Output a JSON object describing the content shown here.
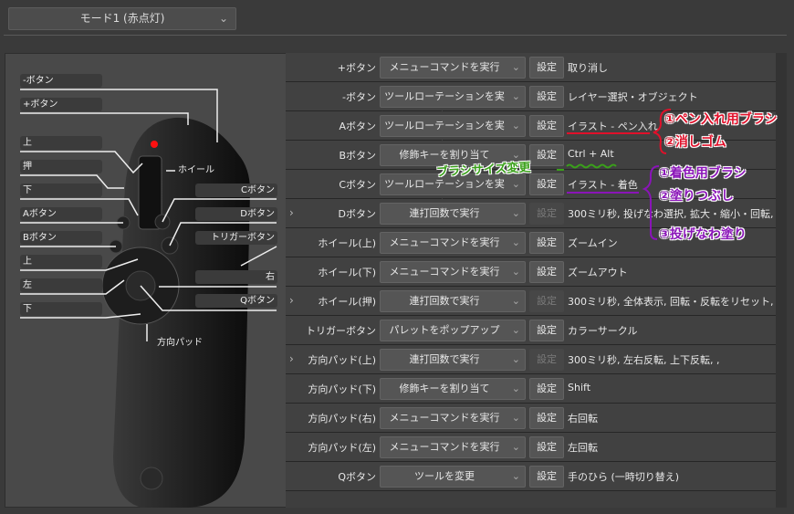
{
  "mode_select": {
    "value": "モード1 (赤点灯)"
  },
  "device": {
    "callouts_left": [
      "-ボタン",
      "+ボタン",
      "上",
      "押",
      "下",
      "Aボタン",
      "Bボタン",
      "上",
      "左",
      "下"
    ],
    "callouts_right": [
      "Cボタン",
      "Dボタン",
      "トリガーボタン",
      "右",
      "Qボタン"
    ],
    "wheel_label": "ホイール",
    "dpad_label": "方向パッド"
  },
  "rows": [
    {
      "label": "+ボタン",
      "expand": false,
      "select": "メニューコマンドを実行",
      "button": "設定",
      "disabled": false,
      "value": "取り消し"
    },
    {
      "label": "-ボタン",
      "expand": false,
      "select": "ツールローテーションを実行",
      "button": "設定",
      "disabled": false,
      "value": "レイヤー選択・オブジェクト"
    },
    {
      "label": "Aボタン",
      "expand": false,
      "select": "ツールローテーションを実行",
      "button": "設定",
      "disabled": false,
      "value": "イラスト - ペン入れ"
    },
    {
      "label": "Bボタン",
      "expand": false,
      "select": "修飾キーを割り当て",
      "button": "設定",
      "disabled": false,
      "value": "Ctrl + Alt"
    },
    {
      "label": "Cボタン",
      "expand": false,
      "select": "ツールローテーションを実行",
      "button": "設定",
      "disabled": false,
      "value": "イラスト - 着色"
    },
    {
      "label": "Dボタン",
      "expand": true,
      "select": "連打回数で実行",
      "button": "設定",
      "disabled": true,
      "value": "300ミリ秒, 投げなわ選択, 拡大・縮小・回転, ,"
    },
    {
      "label": "ホイール(上)",
      "expand": false,
      "select": "メニューコマンドを実行",
      "button": "設定",
      "disabled": false,
      "value": "ズームイン"
    },
    {
      "label": "ホイール(下)",
      "expand": false,
      "select": "メニューコマンドを実行",
      "button": "設定",
      "disabled": false,
      "value": "ズームアウト"
    },
    {
      "label": "ホイール(押)",
      "expand": true,
      "select": "連打回数で実行",
      "button": "設定",
      "disabled": true,
      "value": "300ミリ秒, 全体表示, 回転・反転をリセット, ,"
    },
    {
      "label": "トリガーボタン",
      "expand": false,
      "select": "パレットをポップアップ",
      "button": "設定",
      "disabled": false,
      "value": "カラーサークル"
    },
    {
      "label": "方向パッド(上)",
      "expand": true,
      "select": "連打回数で実行",
      "button": "設定",
      "disabled": true,
      "value": "300ミリ秒, 左右反転, 上下反転, ,"
    },
    {
      "label": "方向パッド(下)",
      "expand": false,
      "select": "修飾キーを割り当て",
      "button": "設定",
      "disabled": false,
      "value": "Shift"
    },
    {
      "label": "方向パッド(右)",
      "expand": false,
      "select": "メニューコマンドを実行",
      "button": "設定",
      "disabled": false,
      "value": "右回転"
    },
    {
      "label": "方向パッド(左)",
      "expand": false,
      "select": "メニューコマンドを実行",
      "button": "設定",
      "disabled": false,
      "value": "左回転"
    },
    {
      "label": "Qボタン",
      "expand": false,
      "select": "ツールを変更",
      "button": "設定",
      "disabled": false,
      "value": "手のひら (一時切り替え)"
    }
  ],
  "annotations": {
    "a_button": [
      "①ペン入れ用ブラシ",
      "②消しゴム"
    ],
    "b_button": "ブラシサイズ変更",
    "c_button": [
      "①着色用ブラシ",
      "②塗りつぶし",
      "③投げなわ塗り"
    ]
  },
  "colors": {
    "red": "#e0102a",
    "green": "#3aa01a",
    "purple": "#8a14b8",
    "led": "#ff1010"
  }
}
